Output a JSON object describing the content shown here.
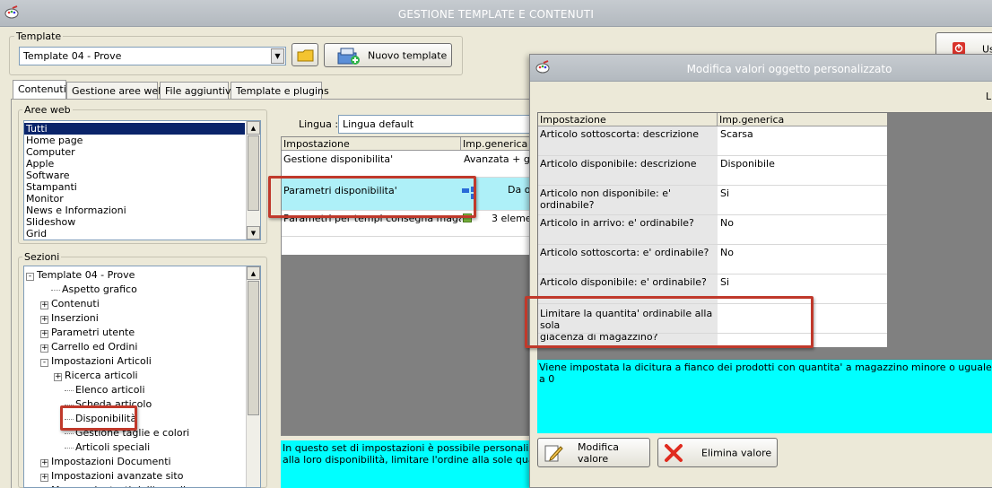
{
  "window": {
    "title": "GESTIONE TEMPLATE E CONTENUTI",
    "app_icon": "app-palette-icon"
  },
  "template": {
    "label": "Template",
    "selected": "Template 04 - Prove",
    "new_button": "Nuovo template"
  },
  "right_truncated": {
    "btn_text": "Us"
  },
  "tabs": [
    {
      "label": "Contenuti"
    },
    {
      "label": "Gestione aree web"
    },
    {
      "label": "File aggiuntivi"
    },
    {
      "label": "Template e plugins"
    }
  ],
  "aree_web": {
    "label": "Aree web",
    "items": [
      "Tutti",
      "Home page",
      "Computer",
      "Apple",
      "Software",
      "Stampanti",
      "Monitor",
      "News e Informazioni",
      "Slideshow",
      "Grid"
    ]
  },
  "sezioni": {
    "label": "Sezioni",
    "nodes": [
      {
        "text": "Template 04 - Prove",
        "pm": "-"
      },
      {
        "text": "Aspetto grafico",
        "pm": ""
      },
      {
        "text": "Contenuti",
        "pm": "+"
      },
      {
        "text": "Inserzioni",
        "pm": "+"
      },
      {
        "text": "Parametri utente",
        "pm": "+"
      },
      {
        "text": "Carrello ed Ordini",
        "pm": "+"
      },
      {
        "text": "Impostazioni Articoli",
        "pm": "-"
      },
      {
        "text": "Ricerca articoli",
        "pm": "+"
      },
      {
        "text": "Elenco articoli",
        "pm": ""
      },
      {
        "text": "Scheda articolo",
        "pm": ""
      },
      {
        "text": "Disponibilità",
        "pm": ""
      },
      {
        "text": "Gestione taglie e colori",
        "pm": ""
      },
      {
        "text": "Articoli speciali",
        "pm": ""
      },
      {
        "text": "Impostazioni Documenti",
        "pm": "+"
      },
      {
        "text": "Impostazioni avanzate sito",
        "pm": "+"
      },
      {
        "text": "Messaggi e testi dell'e-mail",
        "pm": "+"
      }
    ]
  },
  "lingua": {
    "label": "Lingua :",
    "value": "Lingua default"
  },
  "main_grid": {
    "headers": [
      "Impostazione",
      "Imp.generica"
    ],
    "rows": [
      {
        "name": "Gestione disponibilita'",
        "value": "Avanzata + gia"
      },
      {
        "name": "Parametri disponibilita'",
        "value": "Da or"
      },
      {
        "name": "Parametri per tempi consegna magazzini",
        "value": "3 elemen"
      }
    ]
  },
  "main_description": "In questo set di impostazioni è possibile personalizzare: le ... alla loro disponibilità, limitare l'ordine alla sole quantità disp",
  "main_description_lines": [
    "In questo set di impostazioni è possibile personalizzare: le",
    "alla loro disponibilità, limitare l'ordine alla sole quantità disp"
  ],
  "dialog": {
    "title": "Modifica valori oggetto personalizzato",
    "truncated_right": "Li",
    "headers": [
      "Impostazione",
      "Imp.generica"
    ],
    "rows": [
      {
        "name": "Articolo sottoscorta: descrizione",
        "value": "Scarsa"
      },
      {
        "name": "Articolo disponibile: descrizione",
        "value": "Disponibile"
      },
      {
        "name": "Articolo non disponibile: e' ordinabile?",
        "value": "Si"
      },
      {
        "name": "Articolo in arrivo: e' ordinabile?",
        "value": "No"
      },
      {
        "name": "Articolo sottoscorta: e' ordinabile?",
        "value": "No"
      },
      {
        "name": "Articolo disponibile: e' ordinabile?",
        "value": "Si"
      },
      {
        "name": "Limitare la quantita' ordinabile alla sola giacenza di magazzino?",
        "value": ""
      }
    ],
    "row7_line1": "Limitare la quantita' ordinabile alla sola",
    "row7_line2": "giacenza di magazzino?",
    "description": "Viene impostata la dicitura a fianco dei prodotti con quantita' a magazzino minore o uguale a 0",
    "buttons": {
      "modify": "Modifica valore",
      "delete": "Elimina valore"
    }
  },
  "colors": {
    "highlight_cyan": "#00ffff",
    "selected_row": "#aef0f8",
    "annotation_red": "#c0392b"
  }
}
